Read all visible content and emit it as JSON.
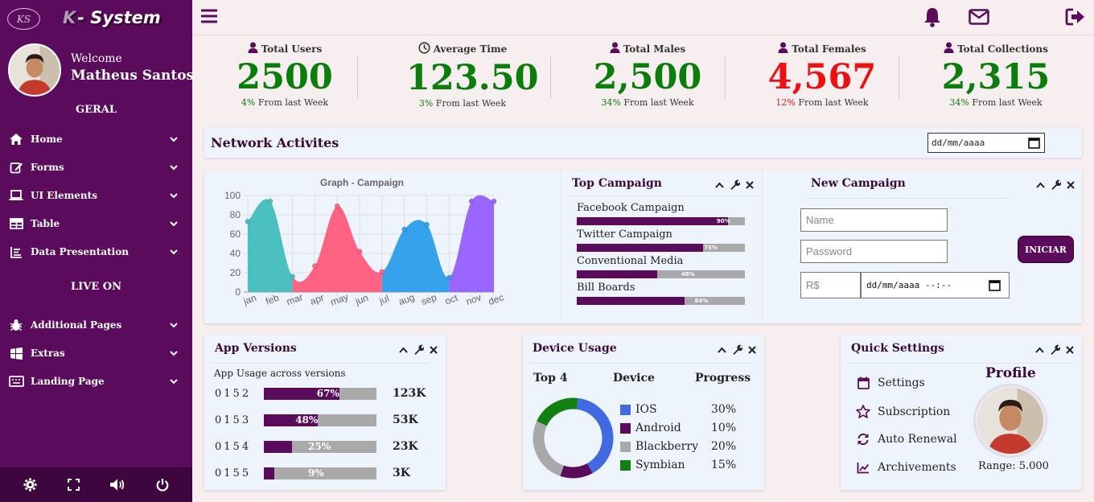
{
  "sidebar": {
    "logo_text": "KS",
    "brand_k": "K",
    "brand_rest": "- System",
    "welcome": "Welcome",
    "user_name": "Matheus Santos",
    "section1": "GERAL",
    "section2": "LIVE ON",
    "items": [
      {
        "label": "Home",
        "icon": "home-icon"
      },
      {
        "label": "Forms",
        "icon": "edit-icon"
      },
      {
        "label": "UI Elements",
        "icon": "laptop-icon"
      },
      {
        "label": "Table",
        "icon": "table-icon"
      },
      {
        "label": "Data Presentation",
        "icon": "list-icon"
      },
      {
        "label": "Additional Pages",
        "icon": "bug-icon"
      },
      {
        "label": "Extras",
        "icon": "windows-icon"
      },
      {
        "label": "Landing Page",
        "icon": "keyboard-icon"
      }
    ],
    "bottom_icons": [
      "gear-icon",
      "fullscreen-icon",
      "volume-icon",
      "power-icon"
    ]
  },
  "stats": [
    {
      "title": "Total Users",
      "value": "2500",
      "sub_pct": "4%",
      "sub_text": "From last Week",
      "color": "#0a7d0a"
    },
    {
      "title": "Average Time",
      "value": "123.50",
      "sub_pct": "3%",
      "sub_text": "From last Week",
      "color": "#0a7d0a"
    },
    {
      "title": "Total Males",
      "value": "2,500",
      "sub_pct": "34%",
      "sub_text": "From last Week",
      "color": "#0a7d0a"
    },
    {
      "title": "Total Females",
      "value": "4,567",
      "sub_pct": "12%",
      "sub_text": "From last Week",
      "color": "#ee1111"
    },
    {
      "title": "Total Collections",
      "value": "2,315",
      "sub_pct": "34%",
      "sub_text": "From last Week",
      "color": "#0a7d0a"
    }
  ],
  "network": {
    "title": "Network Activites",
    "date_placeholder": "dd/mm/aaaa"
  },
  "graph": {
    "title": "Graph - Campaign"
  },
  "chart_data": {
    "type": "area",
    "title": "Graph - Campaign",
    "xlabel": "",
    "ylabel": "",
    "ylim": [
      0,
      100
    ],
    "y_ticks": [
      "0",
      "20",
      "40",
      "60",
      "80",
      "100"
    ],
    "categories": [
      "jan",
      "feb",
      "mar",
      "apr",
      "may",
      "jun",
      "jul",
      "aug",
      "sep",
      "oct",
      "nov",
      "dec"
    ],
    "values": [
      73,
      94,
      16,
      27,
      89,
      42,
      21,
      65,
      70,
      15,
      94,
      94
    ],
    "segment_colors": [
      "#4bc0c0",
      "#ff6384",
      "#36a2eb",
      "#9966ff"
    ]
  },
  "top_campaign": {
    "title": "Top Campaign",
    "items": [
      {
        "label": "Facebook Campaign",
        "value": 90,
        "pct_text": "90%"
      },
      {
        "label": "Twitter Campaign",
        "value": 75,
        "pct_text": "75%"
      },
      {
        "label": "Conventional Media",
        "value": 48,
        "pct_text": "48%"
      },
      {
        "label": "Bill Boards",
        "value": 64,
        "pct_text": "64%"
      }
    ]
  },
  "new_campaign": {
    "title": "New Campaign",
    "name_placeholder": "Name",
    "password_placeholder": "Password",
    "currency_placeholder": "R$",
    "datetime_placeholder": "dd/mm/aaaa --:--",
    "button": "INICIAR"
  },
  "app_versions": {
    "title": "App Versions",
    "subtitle": "App Usage across versions",
    "rows": [
      {
        "version": "0152",
        "value": 67,
        "pct_text": "67%",
        "count": "123K"
      },
      {
        "version": "0153",
        "value": 48,
        "pct_text": "48%",
        "count": "53K"
      },
      {
        "version": "0154",
        "value": 25,
        "pct_text": "25%",
        "count": "23K"
      },
      {
        "version": "0155",
        "value": 9,
        "pct_text": "9%",
        "count": "3K"
      }
    ]
  },
  "device_usage": {
    "title": "Device Usage",
    "col1": "Top 4",
    "col2": "Device",
    "col3": "Progress",
    "items": [
      {
        "name": "IOS",
        "pct": "30%",
        "value": 30,
        "color": "#4169e1"
      },
      {
        "name": "Android",
        "pct": "10%",
        "value": 10,
        "color": "#5b0b5c"
      },
      {
        "name": "Blackberry",
        "pct": "20%",
        "value": 20,
        "color": "#a9a9a9"
      },
      {
        "name": "Symbian",
        "pct": "15%",
        "value": 15,
        "color": "#118011"
      }
    ]
  },
  "quick_settings": {
    "title": "Quick Settings",
    "items": [
      {
        "label": "Settings",
        "icon": "calendar-icon"
      },
      {
        "label": "Subscription",
        "icon": "star-icon"
      },
      {
        "label": "Auto Renewal",
        "icon": "sync-icon"
      },
      {
        "label": "Archivements",
        "icon": "line-chart-icon"
      }
    ],
    "profile_title": "Profile",
    "range": "Range: 5.000"
  },
  "colors": {
    "brand": "#5b0b5c",
    "positive": "#0a7d0a",
    "negative": "#ee1111"
  }
}
